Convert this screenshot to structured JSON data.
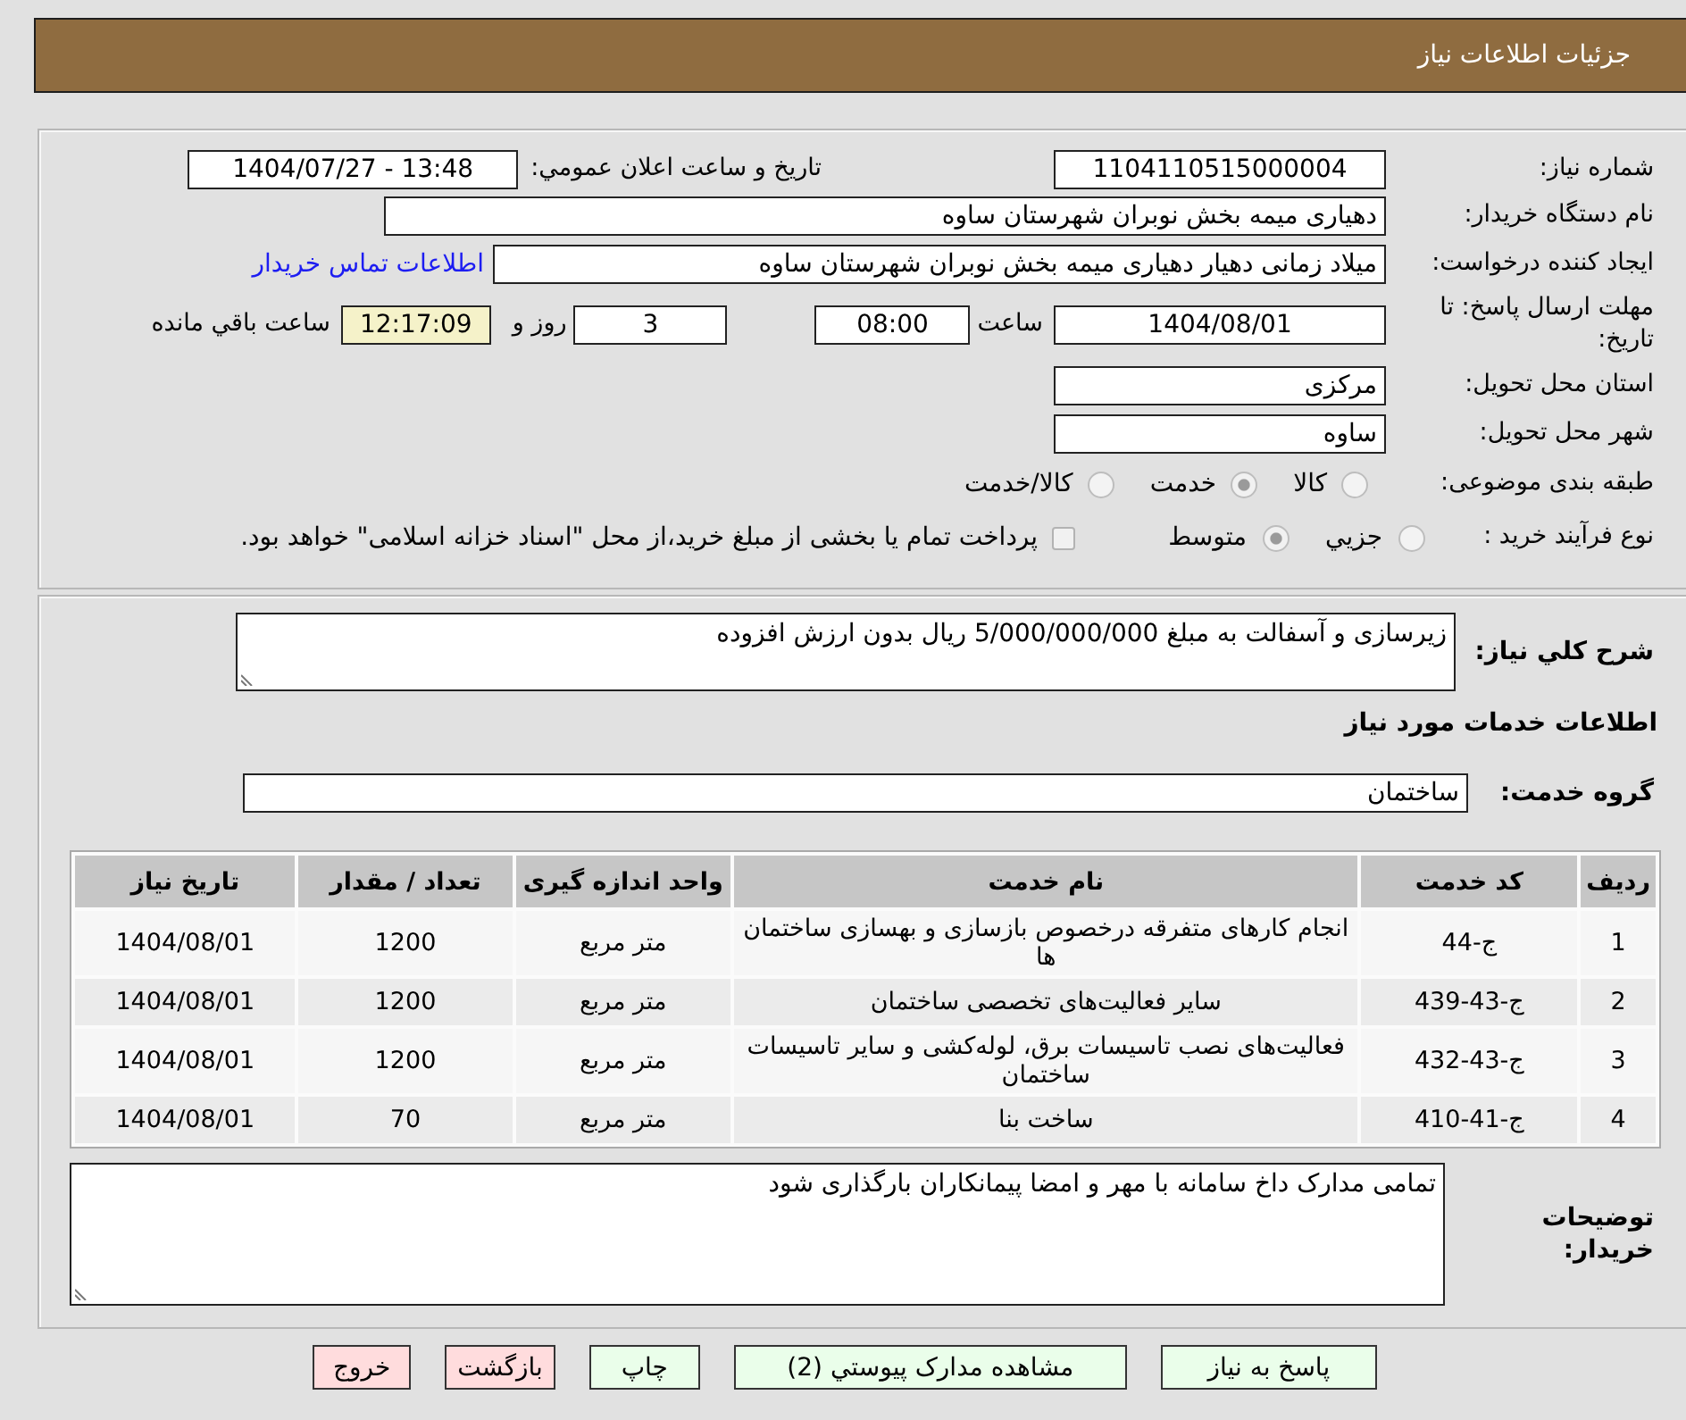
{
  "header": {
    "title": "جزئیات اطلاعات نیاز"
  },
  "details": {
    "need_number": {
      "label": "شماره نیاز:",
      "value": "1104110515000004"
    },
    "announcement": {
      "label": "تاریخ و ساعت اعلان عمومي:",
      "value": "1404/07/27 - 13:48"
    },
    "buyer_organization": {
      "label": "نام دستگاه خریدار:",
      "value": "دهیاری میمه بخش نوبران شهرستان ساوه"
    },
    "requester": {
      "label": "ایجاد کننده درخواست:",
      "value": "میلاد زمانی دهیار دهیاری میمه بخش نوبران شهرستان ساوه",
      "contact_link": "اطلاعات تماس خریدار"
    },
    "deadline": {
      "label": "مهلت ارسال پاسخ: تا تاریخ:",
      "date": "1404/08/01",
      "time_label": "ساعت",
      "time": "08:00",
      "days": "3",
      "days_label": "روز و",
      "remaining_time": "12:17:09",
      "remaining_label": "ساعت باقي مانده"
    },
    "delivery_province": {
      "label": "استان محل تحویل:",
      "value": "مرکزی"
    },
    "delivery_city": {
      "label": "شهر محل تحویل:",
      "value": "ساوه"
    },
    "category": {
      "label": "طبقه بندی موضوعی:",
      "options": [
        {
          "label": "کالا",
          "selected": false
        },
        {
          "label": "خدمت",
          "selected": true
        },
        {
          "label": "کالا/خدمت",
          "selected": false
        }
      ]
    },
    "purchase_process": {
      "label": "نوع فرآیند خرید :",
      "options": [
        {
          "label": "جزيي",
          "selected": false
        },
        {
          "label": "متوسط",
          "selected": true
        }
      ],
      "treasury_payment": {
        "label": "پرداخت تمام یا بخشی از مبلغ خرید،از محل \"اسناد خزانه اسلامی\" خواهد بود.",
        "checked": false
      }
    }
  },
  "needs": {
    "description": {
      "label": "شرح کلي نیاز:",
      "value": "زیرسازی و آسفالت به مبلغ 5/000/000/000 ریال بدون ارزش افزوده"
    },
    "section_title": "اطلاعات خدمات مورد نیاز",
    "service_group": {
      "label": "گروه خدمت:",
      "value": "ساختمان"
    },
    "table": {
      "columns": [
        "ردیف",
        "کد خدمت",
        "نام خدمت",
        "واحد اندازه گیری",
        "تعداد / مقدار",
        "تاریخ نیاز"
      ],
      "rows": [
        [
          "1",
          "ج-44",
          "انجام کارهای متفرقه درخصوص بازسازی و بهسازی ساختمان ها",
          "متر مربع",
          "1200",
          "1404/08/01"
        ],
        [
          "2",
          "ج-43-439",
          "سایر فعالیت‌های تخصصی ساختمان",
          "متر مربع",
          "1200",
          "1404/08/01"
        ],
        [
          "3",
          "ج-43-432",
          "فعالیت‌های نصب تاسیسات برق، لوله‌کشی و سایر تاسیسات ساختمان",
          "متر مربع",
          "1200",
          "1404/08/01"
        ],
        [
          "4",
          "ج-41-410",
          "ساخت بنا",
          "متر مربع",
          "70",
          "1404/08/01"
        ]
      ]
    },
    "buyer_notes": {
      "label": "توضیحات خریدار:",
      "value": "تمامی مدارک داخ سامانه با مهر و امضا پیمانکاران بارگذاری شود"
    }
  },
  "buttons": [
    {
      "label": "پاسخ به نیاز",
      "kind": "action"
    },
    {
      "label": "مشاهده مدارک پیوستي (2)",
      "kind": "action"
    },
    {
      "label": "چاپ",
      "kind": "action"
    },
    {
      "label": "بازگشت",
      "kind": "exit"
    },
    {
      "label": "خروج",
      "kind": "exit"
    }
  ]
}
